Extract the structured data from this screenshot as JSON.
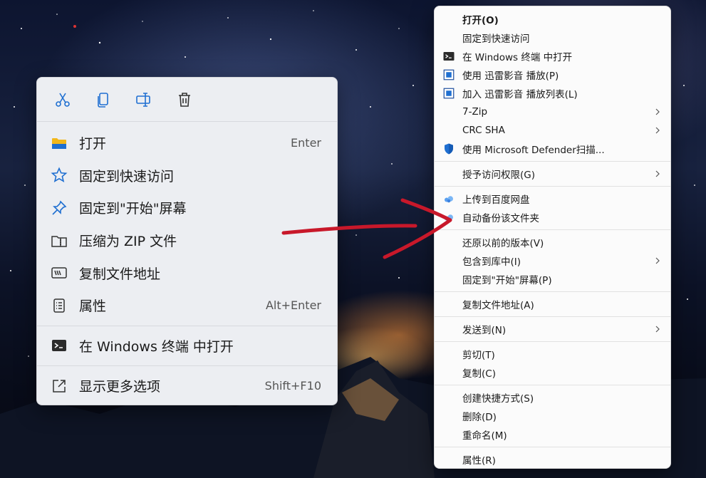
{
  "left_menu": {
    "toolbar": [
      {
        "name": "cut",
        "icon": "scissors-icon"
      },
      {
        "name": "copy",
        "icon": "copy-icon"
      },
      {
        "name": "rename",
        "icon": "rename-icon"
      },
      {
        "name": "delete",
        "icon": "trash-icon"
      }
    ],
    "items": [
      {
        "label": "打开",
        "shortcut": "Enter",
        "icon": "folder-icon"
      },
      {
        "label": "固定到快速访问",
        "shortcut": "",
        "icon": "star-icon"
      },
      {
        "label": "固定到\"开始\"屏幕",
        "shortcut": "",
        "icon": "pin-icon"
      },
      {
        "label": "压缩为 ZIP 文件",
        "shortcut": "",
        "icon": "zip-icon"
      },
      {
        "label": "复制文件地址",
        "shortcut": "",
        "icon": "copy-path-icon"
      },
      {
        "label": "属性",
        "shortcut": "Alt+Enter",
        "icon": "properties-icon"
      },
      {
        "label": "在 Windows 终端 中打开",
        "shortcut": "",
        "icon": "terminal-icon"
      },
      {
        "label": "显示更多选项",
        "shortcut": "Shift+F10",
        "icon": "more-options-icon"
      }
    ]
  },
  "right_menu": {
    "items": [
      {
        "label": "打开(O)"
      },
      {
        "label": "固定到快速访问"
      },
      {
        "label": "在 Windows 终端 中打开"
      },
      {
        "label": "使用 迅雷影音 播放(P)"
      },
      {
        "label": "加入 迅雷影音 播放列表(L)"
      },
      {
        "label": "7-Zip"
      },
      {
        "label": "CRC SHA"
      },
      {
        "label": "使用 Microsoft Defender扫描..."
      },
      {
        "label": "授予访问权限(G)"
      },
      {
        "label": "上传到百度网盘"
      },
      {
        "label": "自动备份该文件夹"
      },
      {
        "label": "还原以前的版本(V)"
      },
      {
        "label": "包含到库中(I)"
      },
      {
        "label": "固定到\"开始\"屏幕(P)"
      },
      {
        "label": "复制文件地址(A)"
      },
      {
        "label": "发送到(N)"
      },
      {
        "label": "剪切(T)"
      },
      {
        "label": "复制(C)"
      },
      {
        "label": "创建快捷方式(S)"
      },
      {
        "label": "删除(D)"
      },
      {
        "label": "重命名(M)"
      },
      {
        "label": "属性(R)"
      }
    ]
  },
  "colors": {
    "accent_blue": "#1f6fd1",
    "folder_yellow": "#f2b71b",
    "annotation_red": "#c8182a"
  }
}
